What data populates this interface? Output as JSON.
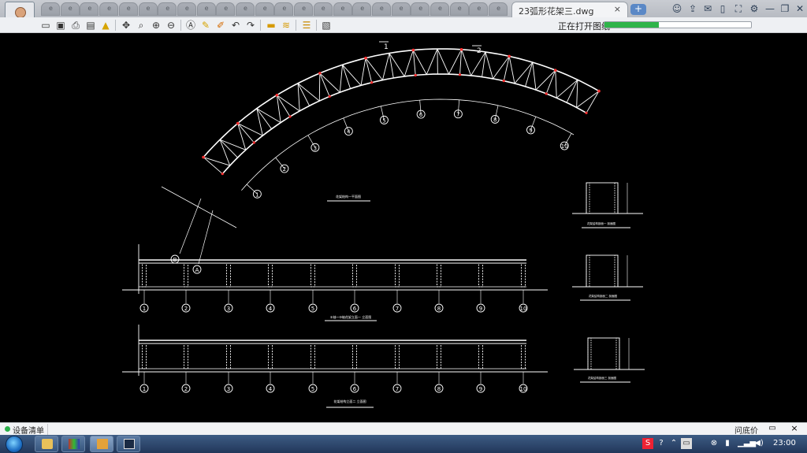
{
  "app": {
    "tab_title": "23弧形花架三.dwg",
    "tab_close": "×",
    "new_tab": "+",
    "status_text": "正在打开图纸",
    "progress": 0.37,
    "small_tab_glyph": "e"
  },
  "toolbar_icons": [
    "open-icon",
    "save-icon",
    "print-icon",
    "export-pdf-icon",
    "lock-icon",
    "pan-icon",
    "zoom-window-icon",
    "zoom-in-icon",
    "zoom-out-icon",
    "text-icon",
    "pencil-icon",
    "highlighter-icon",
    "undo-icon",
    "redo-icon",
    "measure-icon",
    "dimension-icon",
    "layers-icon",
    "properties-icon"
  ],
  "drawing": {
    "arc_grid_labels": [
      "1",
      "2",
      "3",
      "4",
      "5",
      "6",
      "7",
      "8",
      "9",
      "10"
    ],
    "arc_axis_labels": [
      "A",
      "B"
    ],
    "section_marks": [
      "1",
      "2"
    ],
    "plan_title": "花架结构一平面图",
    "elev1_title": "①轴～⑩轴花架立面一 立面图",
    "elev2_title": "花架结构立面二 立面图",
    "elev_labels": [
      "1",
      "2",
      "3",
      "4",
      "5",
      "6",
      "7",
      "8",
      "9",
      "10"
    ],
    "side_titles": [
      "花架结构剖面一 剖面图",
      "花架结构剖面二 剖面图",
      "花架结构剖面三 剖面图"
    ]
  },
  "bottom_panel": {
    "device_list": "设备清单",
    "price": "问底价",
    "close": "×"
  },
  "taskbar": {
    "clock": "23:00"
  },
  "colors": {
    "accent_green": "#2fb44a",
    "canvas": "#000000",
    "truss_red": "#ff3030"
  }
}
